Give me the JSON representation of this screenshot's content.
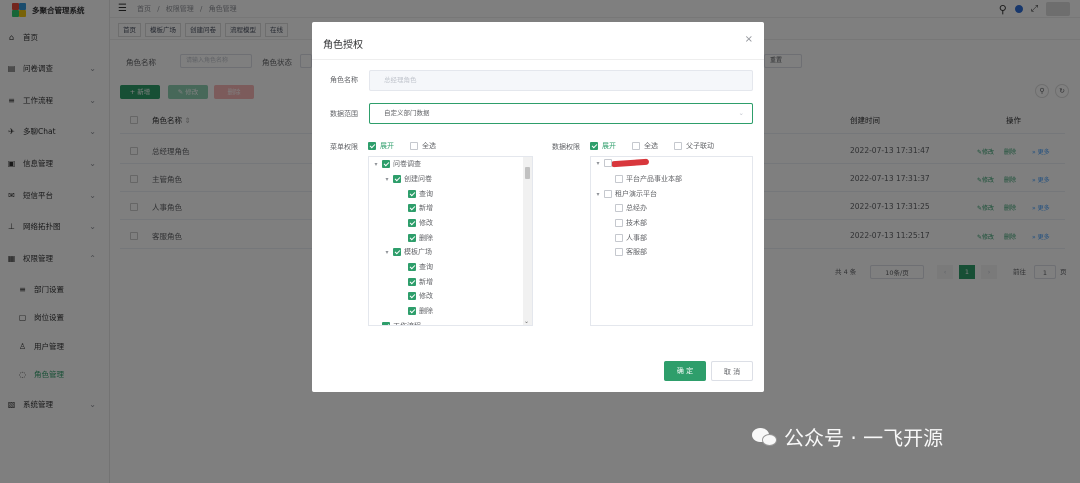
{
  "app": {
    "title": "多聚合管理系统"
  },
  "sidebar": {
    "items": [
      {
        "label": "首页",
        "icon": "home-icon"
      },
      {
        "label": "问卷调查",
        "icon": "survey-icon"
      },
      {
        "label": "工作流程",
        "icon": "workflow-icon"
      },
      {
        "label": "多聊Chat",
        "icon": "chat-icon"
      },
      {
        "label": "信息管理",
        "icon": "info-icon"
      },
      {
        "label": "短信平台",
        "icon": "sms-icon"
      },
      {
        "label": "网络拓扑图",
        "icon": "topology-icon"
      },
      {
        "label": "权限管理",
        "icon": "permission-icon"
      }
    ],
    "sub_items": [
      {
        "label": "部门设置",
        "icon": "department-icon"
      },
      {
        "label": "岗位设置",
        "icon": "position-icon"
      },
      {
        "label": "用户管理",
        "icon": "user-icon"
      },
      {
        "label": "角色管理",
        "icon": "role-icon"
      }
    ],
    "last_item": {
      "label": "系统管理",
      "icon": "system-icon"
    }
  },
  "breadcrumb": {
    "home": "首页",
    "sep": "/",
    "parent": "权限管理",
    "current": "角色管理"
  },
  "tags": [
    "首页",
    "模板广场",
    "创建问卷",
    "流程模型",
    "在线"
  ],
  "filters": {
    "role_name_label": "角色名称",
    "role_name_placeholder": "请输入角色名称",
    "role_status_label": "角色状态",
    "reset_label": "重置"
  },
  "toolbar": {
    "add_label": "+ 新增",
    "edit_label": "✎ 修改",
    "delete_label": "删除"
  },
  "table": {
    "headers": {
      "name": "角色名称",
      "created": "创建时间",
      "ops": "操作"
    },
    "sort_mark": "⇕",
    "rows": [
      {
        "name": "总经理角色",
        "created": "2022-07-13 17:31:47"
      },
      {
        "name": "主管角色",
        "created": "2022-07-13 17:31:37"
      },
      {
        "name": "人事角色",
        "created": "2022-07-13 17:31:25"
      },
      {
        "name": "客服角色",
        "created": "2022-07-13 11:25:17"
      }
    ],
    "op_edit": "✎修改",
    "op_delete": "删除",
    "op_more": "» 更多"
  },
  "pagination": {
    "total": "共 4 条",
    "page_size": "10条/页",
    "current": "1",
    "goto_label": "前往",
    "goto_value": "1",
    "page_suffix": "页"
  },
  "dialog": {
    "title": "角色授权",
    "close": "×",
    "role_name_label": "角色名称",
    "role_name_value": "总经理角色",
    "scope_label": "数据范围",
    "scope_value": "自定义部门数据",
    "menu_perm_label": "菜单权限",
    "data_perm_label": "数据权限",
    "expand_label": "展开",
    "select_all_label": "全选",
    "parent_child_label": "父子联动",
    "menu_tree": [
      {
        "label": "问卷调查",
        "level": 0,
        "caret": true
      },
      {
        "label": "创建问卷",
        "level": 1,
        "caret": true
      },
      {
        "label": "查询",
        "level": 2,
        "caret": false
      },
      {
        "label": "新增",
        "level": 2,
        "caret": false
      },
      {
        "label": "修改",
        "level": 2,
        "caret": false
      },
      {
        "label": "删除",
        "level": 2,
        "caret": false
      },
      {
        "label": "模板广场",
        "level": 1,
        "caret": true
      },
      {
        "label": "查询",
        "level": 2,
        "caret": false
      },
      {
        "label": "新增",
        "level": 2,
        "caret": false
      },
      {
        "label": "修改",
        "level": 2,
        "caret": false
      },
      {
        "label": "删除",
        "level": 2,
        "caret": false
      },
      {
        "label": "工作流程",
        "level": 0,
        "caret": true
      }
    ],
    "data_tree": [
      {
        "label": "",
        "level": 0,
        "caret": true
      },
      {
        "label": "平台产品事业本部",
        "level": 1,
        "caret": false
      },
      {
        "label": "租户演示平台",
        "level": 0,
        "caret": true
      },
      {
        "label": "总经办",
        "level": 1,
        "caret": false
      },
      {
        "label": "技术部",
        "level": 1,
        "caret": false
      },
      {
        "label": "人事部",
        "level": 1,
        "caret": false
      },
      {
        "label": "客服部",
        "level": 1,
        "caret": false
      }
    ],
    "confirm_label": "确 定",
    "cancel_label": "取 消"
  },
  "watermark": {
    "text": "公众号 · 一飞开源"
  },
  "colors": {
    "accent": "#2e9e6b",
    "danger": "#f56c6c",
    "warning": "#e6a23c"
  }
}
